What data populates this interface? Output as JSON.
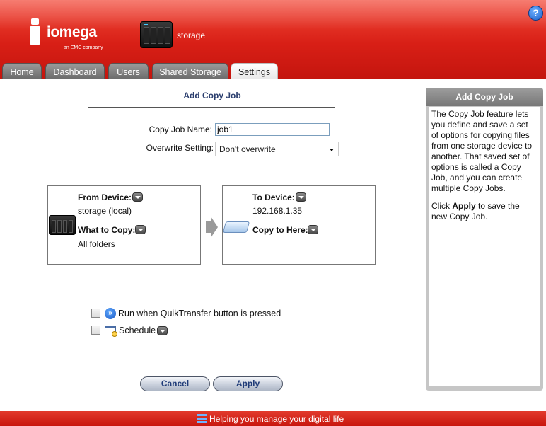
{
  "brand": {
    "name": "iomega",
    "tagline": "an EMC company"
  },
  "device": {
    "name": "storage"
  },
  "tabs": [
    {
      "label": "Home"
    },
    {
      "label": "Dashboard"
    },
    {
      "label": "Users"
    },
    {
      "label": "Shared Storage"
    },
    {
      "label": "Settings",
      "active": true
    }
  ],
  "page": {
    "title": "Add Copy Job"
  },
  "form": {
    "job_name_label": "Copy Job Name:",
    "job_name_value": "job1",
    "overwrite_label": "Overwrite Setting:",
    "overwrite_value": "Don't overwrite"
  },
  "from_box": {
    "device_label": "From Device:",
    "device_value": "storage (local)",
    "what_label": "What to Copy:",
    "what_value": "All folders"
  },
  "to_box": {
    "device_label": "To Device:",
    "device_value": "192.168.1.35",
    "where_label": "Copy to Here:"
  },
  "options": {
    "quiktransfer_label": "Run when QuikTransfer button is pressed",
    "schedule_label": "Schedule"
  },
  "buttons": {
    "cancel": "Cancel",
    "apply": "Apply"
  },
  "help": {
    "title": "Add Copy Job",
    "para1": "The Copy Job feature lets you define and save a set of options for copying files from one storage device to another. That saved set of options is called a Copy Job, and you can create multiple Copy Jobs.",
    "para2_pre": "Click ",
    "para2_bold": "Apply",
    "para2_post": " to save the new Copy Job."
  },
  "footer": {
    "text": "Helping you manage your digital life"
  },
  "colors": {
    "brand_red": "#d81f16",
    "link_blue": "#2b3e6e",
    "button_text": "#1f3b78"
  },
  "icons": [
    "help-icon",
    "nas-device-icon",
    "dropdown-icon",
    "arrow-right-icon",
    "drive-icon",
    "quiktransfer-icon",
    "calendar-icon",
    "stripes-icon"
  ]
}
